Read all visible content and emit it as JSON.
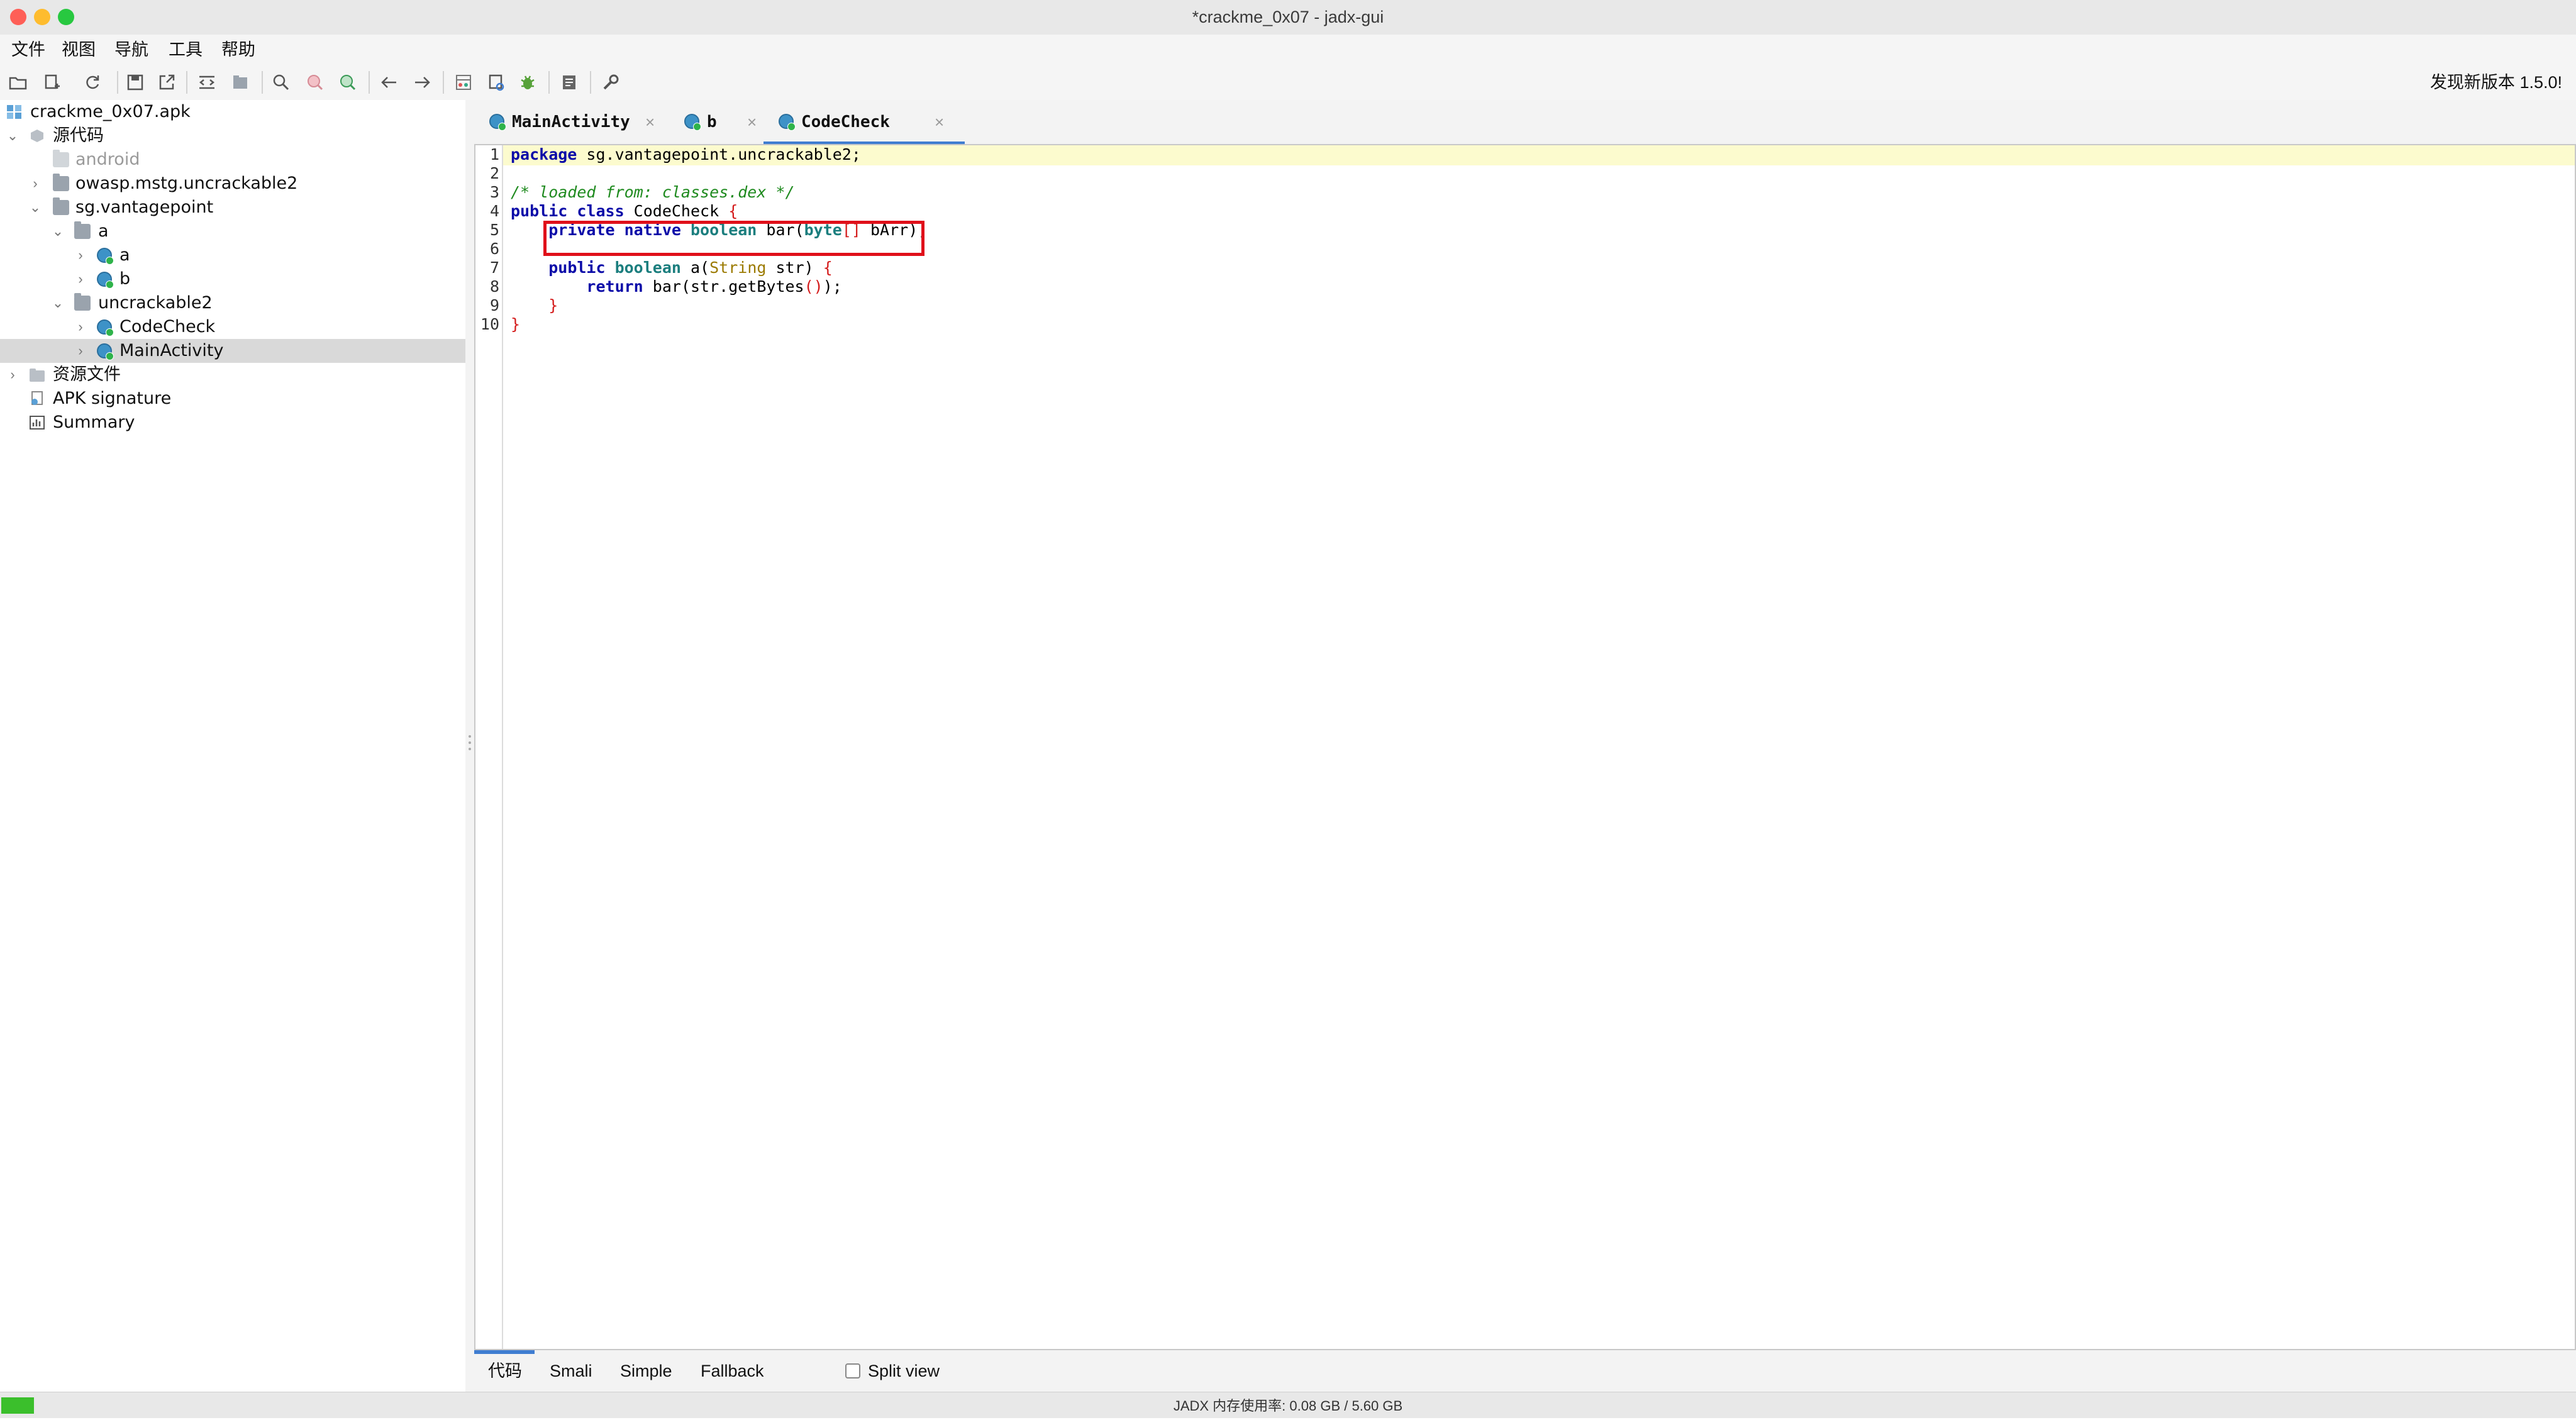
{
  "window": {
    "title": "*crackme_0x07 - jadx-gui",
    "colors": {
      "close": "#fe5f57",
      "minimize": "#febc2e",
      "zoom": "#28c840"
    }
  },
  "menu": [
    "文件",
    "视图",
    "导航",
    "工具",
    "帮助"
  ],
  "toolbar": {
    "icons": [
      "open-file-icon",
      "add-files-icon",
      "reload-icon",
      "save-all-icon",
      "export-icon",
      "sync-icon",
      "flatten-packages-icon",
      "search-icon",
      "find-usage-icon",
      "find-class-icon",
      "back-arrow-icon",
      "forward-arrow-icon",
      "deobfuscation-icon",
      "quark-icon",
      "debug-icon",
      "log-viewer-icon",
      "preferences-icon"
    ],
    "update_notice": "发现新版本 1.5.0!"
  },
  "tree": {
    "root": "crackme_0x07.apk",
    "source_code": "源代码",
    "android": "android",
    "owasp": "owasp.mstg.uncrackable2",
    "sg": "sg.vantagepoint",
    "pkg_a": "a",
    "class_a": "a",
    "class_b": "b",
    "uncrackable2": "uncrackable2",
    "codecheck": "CodeCheck",
    "mainactivity": "MainActivity",
    "resources": "资源文件",
    "apk_signature": "APK signature",
    "summary": "Summary"
  },
  "tabs": [
    {
      "label": "MainActivity",
      "active": false
    },
    {
      "label": "b",
      "active": false
    },
    {
      "label": "CodeCheck",
      "active": true
    }
  ],
  "code": {
    "line_numbers": [
      "1",
      "2",
      "3",
      "4",
      "5",
      "6",
      "7",
      "8",
      "9",
      "10"
    ],
    "l1_kw": "package",
    "l1_rest": " sg.vantagepoint.uncrackable2;",
    "l3_comment": "/* loaded from: classes.dex */",
    "l4_kw": "public class",
    "l4_name": " CodeCheck ",
    "l4_brace": "{",
    "l5_kw": "private native",
    "l5_type": " boolean",
    "l5_rest1": " bar(",
    "l5_byte": "byte",
    "l5_arr": "[]",
    "l5_rest2": " bArr);",
    "l7_kw": "public",
    "l7_type": " boolean",
    "l7_rest1": " a(",
    "l7_string": "String",
    "l7_rest2": " str) ",
    "l7_brace": "{",
    "l8_kw": "return",
    "l8_rest1": " bar(str.getBytes",
    "l8_paren": "()",
    "l8_rest2": ");",
    "l9_brace": "}",
    "l10_brace": "}"
  },
  "view_tabs": {
    "code": "代码",
    "smali": "Smali",
    "simple": "Simple",
    "fallback": "Fallback",
    "split_view": "Split view",
    "split_view_checked": false
  },
  "status": {
    "memory_text": "JADX 内存使用率: 0.08 GB / 5.60 GB",
    "memory_used_fraction": 0.014
  }
}
